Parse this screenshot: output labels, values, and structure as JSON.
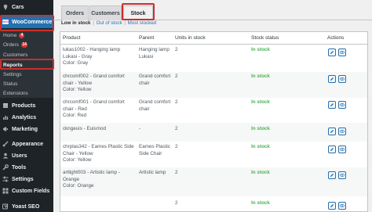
{
  "sidebar": {
    "items": [
      {
        "label": "Cars",
        "icon": "pin-icon"
      },
      {
        "label": "WooCommerce",
        "icon": "woocommerce-icon",
        "badge_text": "WOO"
      },
      {
        "label": "Products",
        "icon": "box-icon"
      },
      {
        "label": "Analytics",
        "icon": "bar-chart-icon"
      },
      {
        "label": "Marketing",
        "icon": "megaphone-icon"
      },
      {
        "label": "Appearance",
        "icon": "paintbrush-icon"
      },
      {
        "label": "Users",
        "icon": "user-icon"
      },
      {
        "label": "Tools",
        "icon": "wrench-icon"
      },
      {
        "label": "Settings",
        "icon": "sliders-icon"
      },
      {
        "label": "Custom Fields",
        "icon": "grid-icon"
      },
      {
        "label": "Yoast SEO",
        "icon": "yoast-icon"
      }
    ],
    "submenu": [
      {
        "label": "Home",
        "badge": "4"
      },
      {
        "label": "Orders",
        "badge": "14"
      },
      {
        "label": "Customers"
      },
      {
        "label": "Reports"
      },
      {
        "label": "Settings"
      },
      {
        "label": "Status"
      },
      {
        "label": "Extensions"
      }
    ]
  },
  "tabs": [
    {
      "label": "Orders"
    },
    {
      "label": "Customers"
    },
    {
      "label": "Stock"
    }
  ],
  "filters": {
    "low": "Low in stock",
    "sep": "|",
    "out": "Out of stock",
    "most": "Most stocked"
  },
  "table": {
    "headers": {
      "product": "Product",
      "parent": "Parent",
      "units": "Units in stock",
      "status": "Stock status",
      "actions": "Actions"
    },
    "rows": [
      {
        "product": "lukas1002 - Hanging lamp Lukasi - Gray",
        "color": "Color: Gray",
        "parent": "Hanging lamp Lukasi",
        "units": "2",
        "status": "In stock"
      },
      {
        "product": "chrcomf002 - Grand comfort chair - Yellow",
        "color": "Color: Yellow",
        "parent": "Grand comfort chair",
        "units": "2",
        "status": "In stock"
      },
      {
        "product": "chrcomf001 - Grand comfort chair - Red",
        "color": "Color: Red",
        "parent": "Grand comfort chair",
        "units": "2",
        "status": "In stock"
      },
      {
        "product": "ckngeuis - Euismod",
        "color": "",
        "parent": "-",
        "units": "2",
        "status": "In stock"
      },
      {
        "product": "chrplas342 - Eames Plastic Side Chair - Yellow",
        "color": "Color: Yellow",
        "parent": "Eames Plastic Side Chair",
        "units": "2",
        "status": "In stock"
      },
      {
        "product": "artlight003 - Artistic lamp - Orange",
        "color": "Color: Orange",
        "parent": "Artistic lamp",
        "units": "2",
        "status": "In stock"
      },
      {
        "product": "",
        "color": "",
        "parent": "",
        "units": "2",
        "status": "In stock"
      }
    ],
    "action_icons": [
      "pencil-icon",
      "eye-icon"
    ]
  },
  "colors": {
    "sidebar_bg": "#1d2327",
    "submenu_bg": "#2c3338",
    "accent": "#2271b1",
    "in_stock": "#46b450",
    "highlight": "#c9302c",
    "badge": "#d63638"
  }
}
